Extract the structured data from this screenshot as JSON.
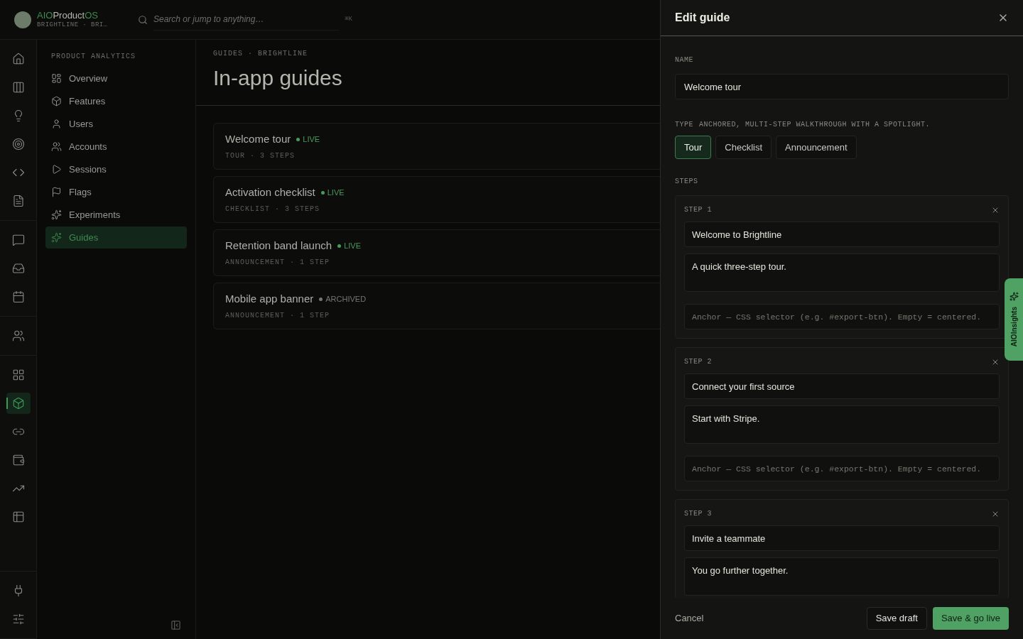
{
  "brand": {
    "prefix": "AIO",
    "name": "Product",
    "suffix": "OS",
    "workspace": "BRIGHTLINE · BRI…"
  },
  "search": {
    "placeholder": "Search or jump to anything…",
    "shortcut": "⌘K"
  },
  "rail": [
    [
      {
        "selected": false
      },
      {
        "selected": false
      },
      {
        "selected": false
      },
      {
        "selected": false
      },
      {
        "selected": false
      },
      {
        "selected": false
      }
    ],
    [
      {
        "selected": false
      },
      {
        "selected": false
      },
      {
        "selected": false
      }
    ],
    [
      {
        "selected": false
      }
    ],
    [
      {
        "selected": false
      },
      {
        "selected": true
      },
      {
        "selected": false
      },
      {
        "selected": false
      },
      {
        "selected": false
      },
      {
        "selected": false
      }
    ],
    [
      {
        "selected": false
      },
      {
        "selected": false
      }
    ]
  ],
  "sidebar": {
    "section": "PRODUCT ANALYTICS",
    "items": [
      {
        "label": "Overview",
        "selected": false
      },
      {
        "label": "Features",
        "selected": false
      },
      {
        "label": "Users",
        "selected": false
      },
      {
        "label": "Accounts",
        "selected": false
      },
      {
        "label": "Sessions",
        "selected": false
      },
      {
        "label": "Flags",
        "selected": false
      },
      {
        "label": "Experiments",
        "selected": false
      },
      {
        "label": "Guides",
        "selected": true
      }
    ]
  },
  "page": {
    "breadcrumb": "GUIDES · BRIGHTLINE",
    "title": "In-app guides"
  },
  "guides": [
    {
      "title": "Welcome tour",
      "status": "LIVE",
      "color": "#4c9a5e",
      "meta": "TOUR · 3 STEPS"
    },
    {
      "title": "Activation checklist",
      "status": "LIVE",
      "color": "#4c9a5e",
      "meta": "CHECKLIST · 3 STEPS"
    },
    {
      "title": "Retention band launch",
      "status": "LIVE",
      "color": "#4c9a5e",
      "meta": "ANNOUNCEMENT · 1 STEP"
    },
    {
      "title": "Mobile app banner",
      "status": "ARCHIVED",
      "color": "#77776f",
      "meta": "ANNOUNCEMENT · 1 STEP"
    }
  ],
  "drawer": {
    "title": "Edit guide",
    "name_label": "NAME",
    "name_value": "Welcome tour",
    "type_label": "TYPE",
    "type_hint": "ANCHORED, MULTI-STEP WALKTHROUGH WITH A SPOTLIGHT.",
    "types": [
      {
        "label": "Tour",
        "selected": true
      },
      {
        "label": "Checklist",
        "selected": false
      },
      {
        "label": "Announcement",
        "selected": false
      }
    ],
    "steps_label": "STEPS",
    "steps": [
      {
        "label": "STEP 1",
        "title": "Welcome to Brightline",
        "body": "A quick three-step tour.",
        "anchor_placeholder": "Anchor — CSS selector (e.g. #export-btn). Empty = centered."
      },
      {
        "label": "STEP 2",
        "title": "Connect your first source",
        "body": "Start with Stripe.",
        "anchor_placeholder": "Anchor — CSS selector (e.g. #export-btn). Empty = centered."
      },
      {
        "label": "STEP 3",
        "title": "Invite a teammate",
        "body": "You go further together."
      }
    ],
    "cancel": "Cancel",
    "save_draft": "Save draft",
    "save_live": "Save & go live"
  },
  "insights_tab": "AIOInsights"
}
